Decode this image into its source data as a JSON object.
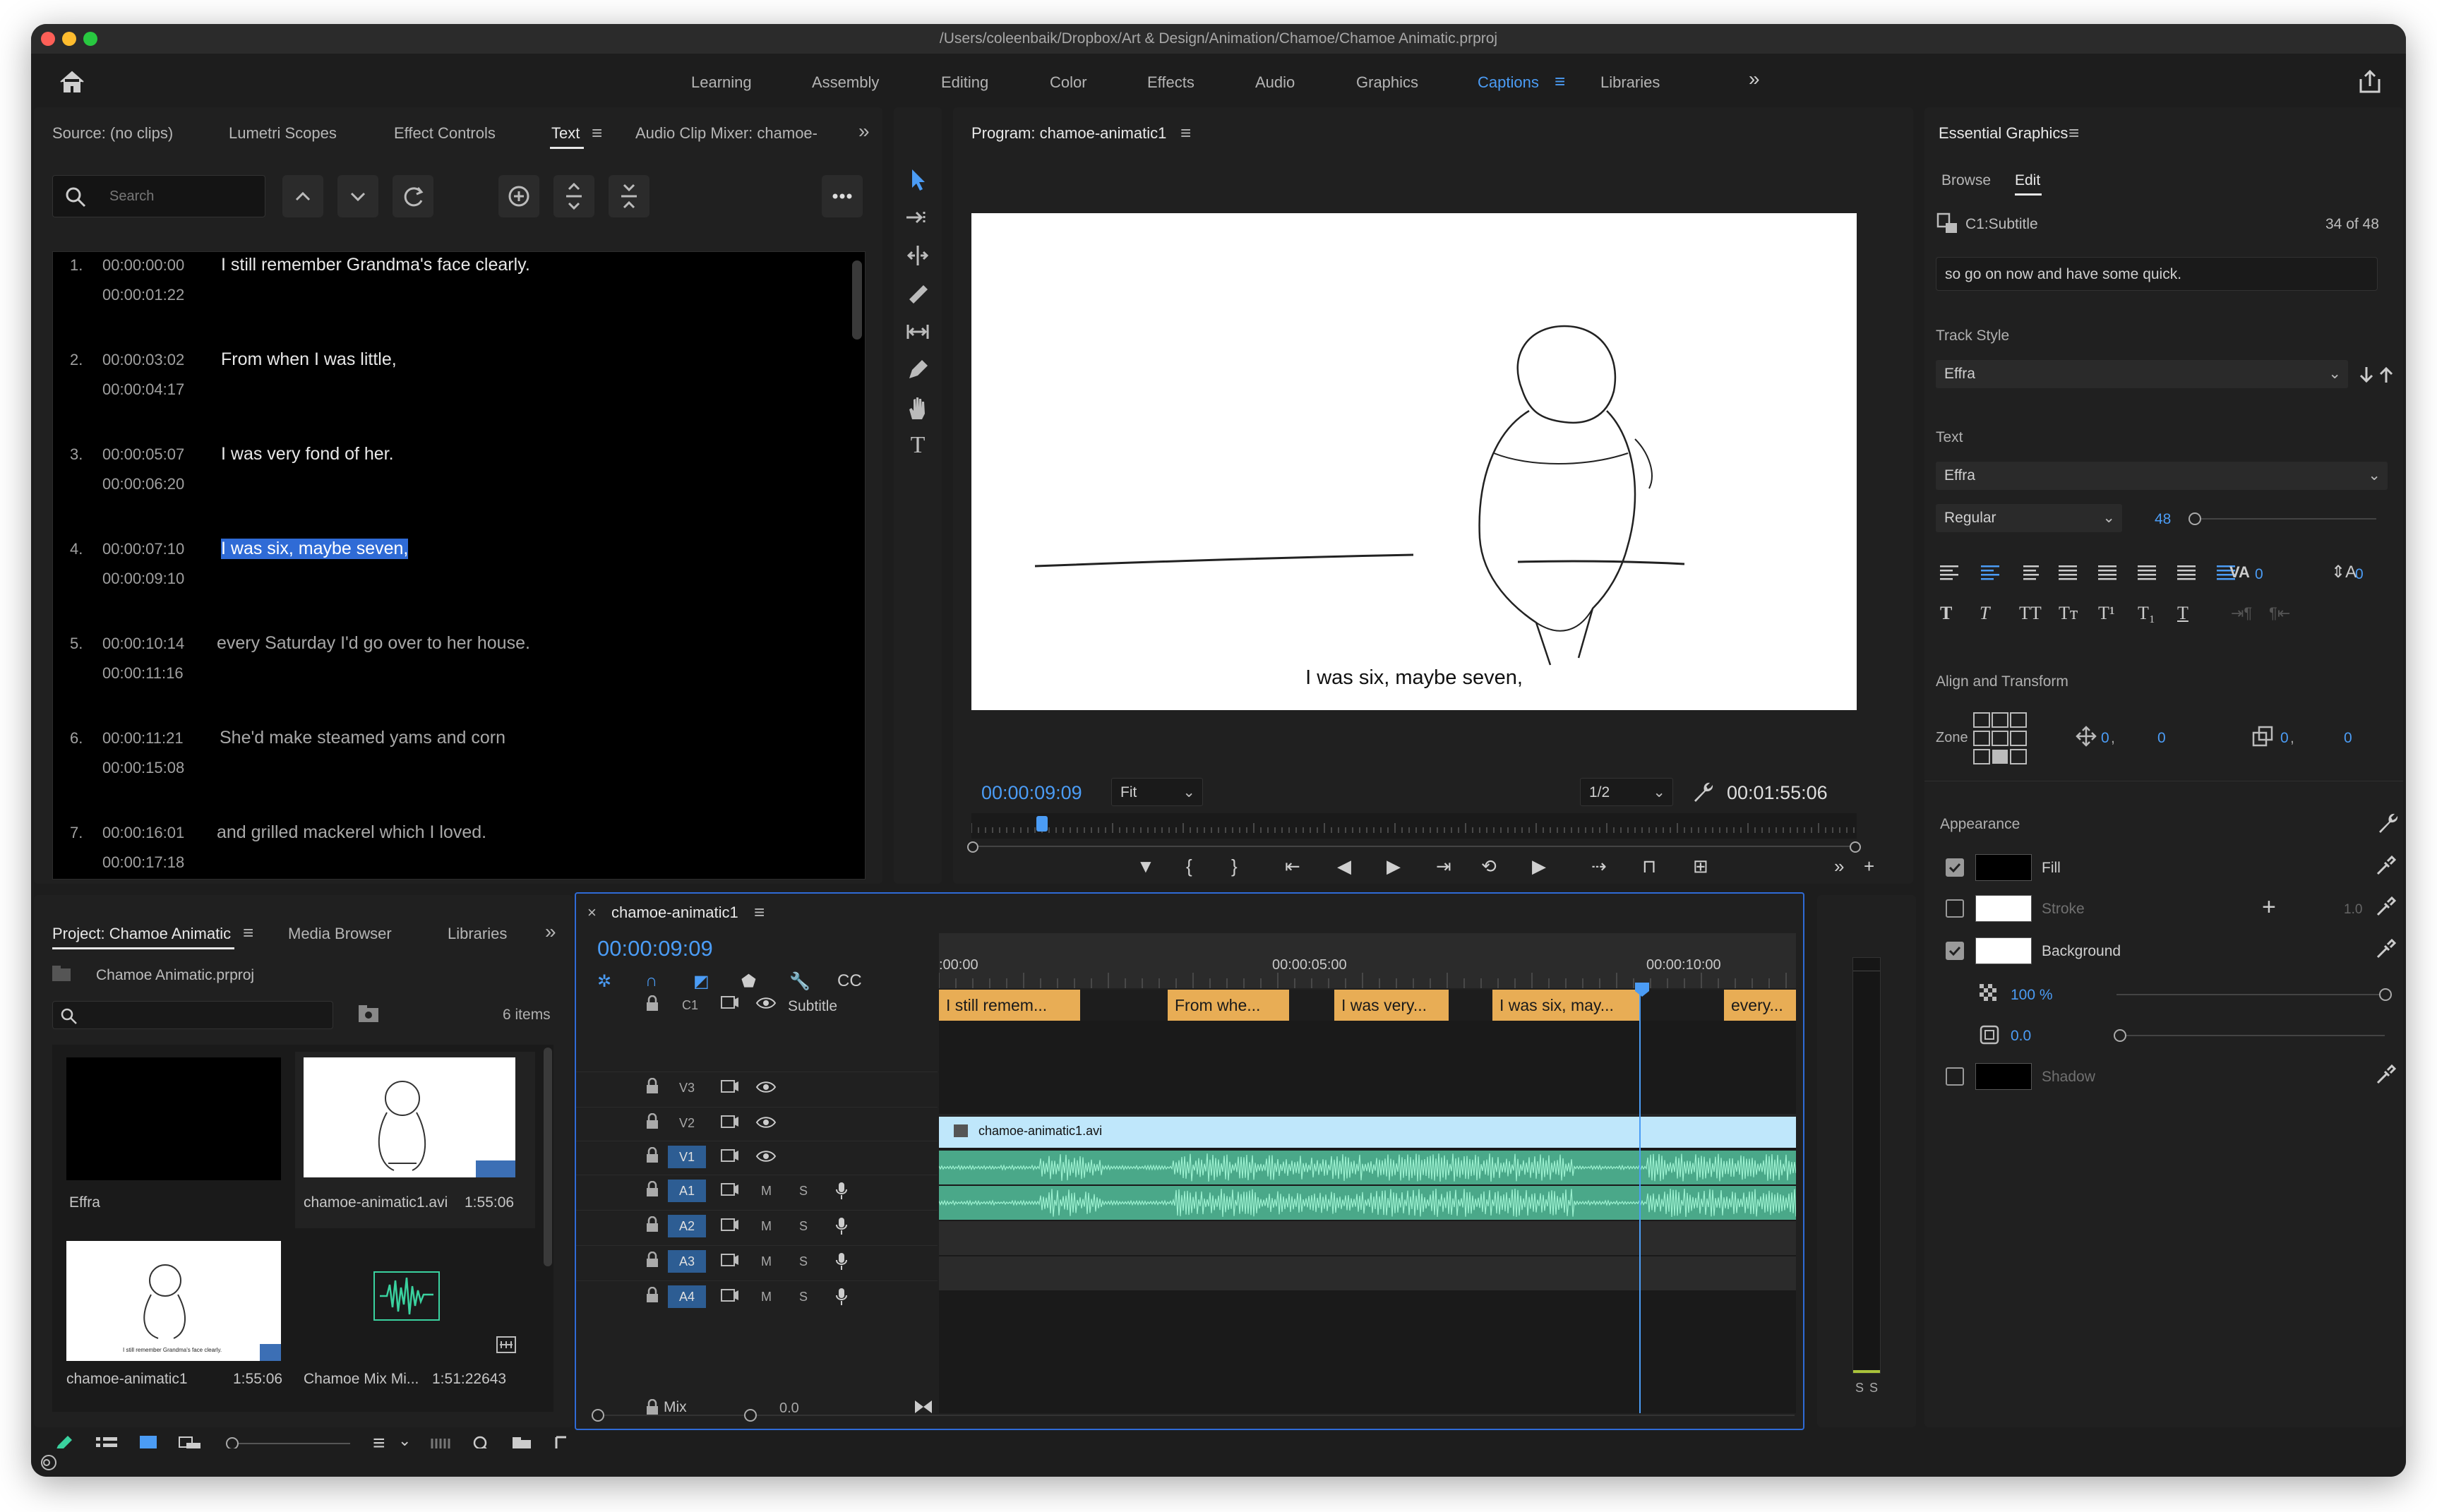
{
  "window": {
    "title": "/Users/coleenbaik/Dropbox/Art & Design/Animation/Chamoe/Chamoe Animatic.prproj"
  },
  "workspaces": [
    "Learning",
    "Assembly",
    "Editing",
    "Color",
    "Effects",
    "Audio",
    "Graphics",
    "Captions",
    "Libraries"
  ],
  "active_workspace": "Captions",
  "source_panel": {
    "tabs": [
      "Source: (no clips)",
      "Lumetri Scopes",
      "Effect Controls",
      "Text",
      "Audio Clip Mixer: chamoe-"
    ],
    "active_tab": "Text",
    "search_placeholder": "Search",
    "captions": [
      {
        "n": "1.",
        "in": "00:00:00:00",
        "out": "00:00:01:22",
        "text": "I still remember Grandma's face clearly."
      },
      {
        "n": "2.",
        "in": "00:00:03:02",
        "out": "00:00:04:17",
        "text": "From when I was little,"
      },
      {
        "n": "3.",
        "in": "00:00:05:07",
        "out": "00:00:06:20",
        "text": "I was very fond of her."
      },
      {
        "n": "4.",
        "in": "00:00:07:10",
        "out": "00:00:09:10",
        "text": "I was six, maybe seven,"
      },
      {
        "n": "5.",
        "in": "00:00:10:14",
        "out": "00:00:11:16",
        "text": "every Saturday I'd go over to her house."
      },
      {
        "n": "6.",
        "in": "00:00:11:21",
        "out": "00:00:15:08",
        "text": "She'd make steamed yams and corn"
      },
      {
        "n": "7.",
        "in": "00:00:16:01",
        "out": "00:00:17:18",
        "text": "and grilled mackerel which I loved."
      }
    ]
  },
  "program": {
    "title": "Program: chamoe-animatic1",
    "caption": "I was six, maybe seven,",
    "timecode": "00:00:09:09",
    "fit": "Fit",
    "resolution": "1/2",
    "duration": "00:01:55:06",
    "playhead_fraction": 0.08
  },
  "essential_graphics": {
    "title": "Essential Graphics",
    "tabs": [
      "Browse",
      "Edit"
    ],
    "active_tab": "Edit",
    "layer": "C1:Subtitle",
    "count": "34 of 48",
    "caption_text": "so go on now and have some quick.",
    "track_style_label": "Track Style",
    "track_style": "Effra",
    "text_label": "Text",
    "font": "Effra",
    "font_style": "Regular",
    "font_size": "48",
    "tracking": "0",
    "leading": "0",
    "align_label": "Align and Transform",
    "zone_label": "Zone",
    "pos_x": "0",
    "pos_y": "0",
    "scale_x": "0",
    "scale_y": "0",
    "appearance_label": "Appearance",
    "fill_label": "Fill",
    "stroke_label": "Stroke",
    "stroke_width": "1.0",
    "background_label": "Background",
    "opacity": "100 %",
    "corner": "0.0",
    "shadow_label": "Shadow",
    "fill_color": "#000000",
    "background_color": "#ffffff",
    "shadow_color": "#000000"
  },
  "project": {
    "tabs": [
      "Project: Chamoe Animatic",
      "Media Browser",
      "Libraries"
    ],
    "active_tab": "Project: Chamoe Animatic",
    "file": "Chamoe Animatic.prproj",
    "items_count": "6 items",
    "items": [
      {
        "name": "Effra",
        "duration": ""
      },
      {
        "name": "chamoe-animatic1.avi",
        "duration": "1:55:06"
      },
      {
        "name": "chamoe-animatic1",
        "duration": "1:55:06"
      },
      {
        "name": "Chamoe Mix Mi...",
        "duration": "1:51:22643"
      }
    ],
    "thumb_caption": "I still remember Grandma's face clearly."
  },
  "timeline": {
    "title": "chamoe-animatic1",
    "timecode": "00:00:09:09",
    "ruler": [
      ":00:00",
      "00:00:05:00",
      "00:00:10:00"
    ],
    "subtitle_track": "Subtitle",
    "c1": "C1",
    "video_tracks": [
      "V3",
      "V2",
      "V1"
    ],
    "audio_tracks": [
      "A1",
      "A2",
      "A3",
      "A4"
    ],
    "mix_label": "Mix",
    "mix_value": "0.0",
    "video_clip": "chamoe-animatic1.avi",
    "caption_clips": [
      "I still remem...",
      "From whe...",
      "I was very...",
      "I was six, may...",
      "every..."
    ],
    "m": "M",
    "s": "S"
  },
  "meter": {
    "labels": [
      "S",
      "S"
    ]
  }
}
